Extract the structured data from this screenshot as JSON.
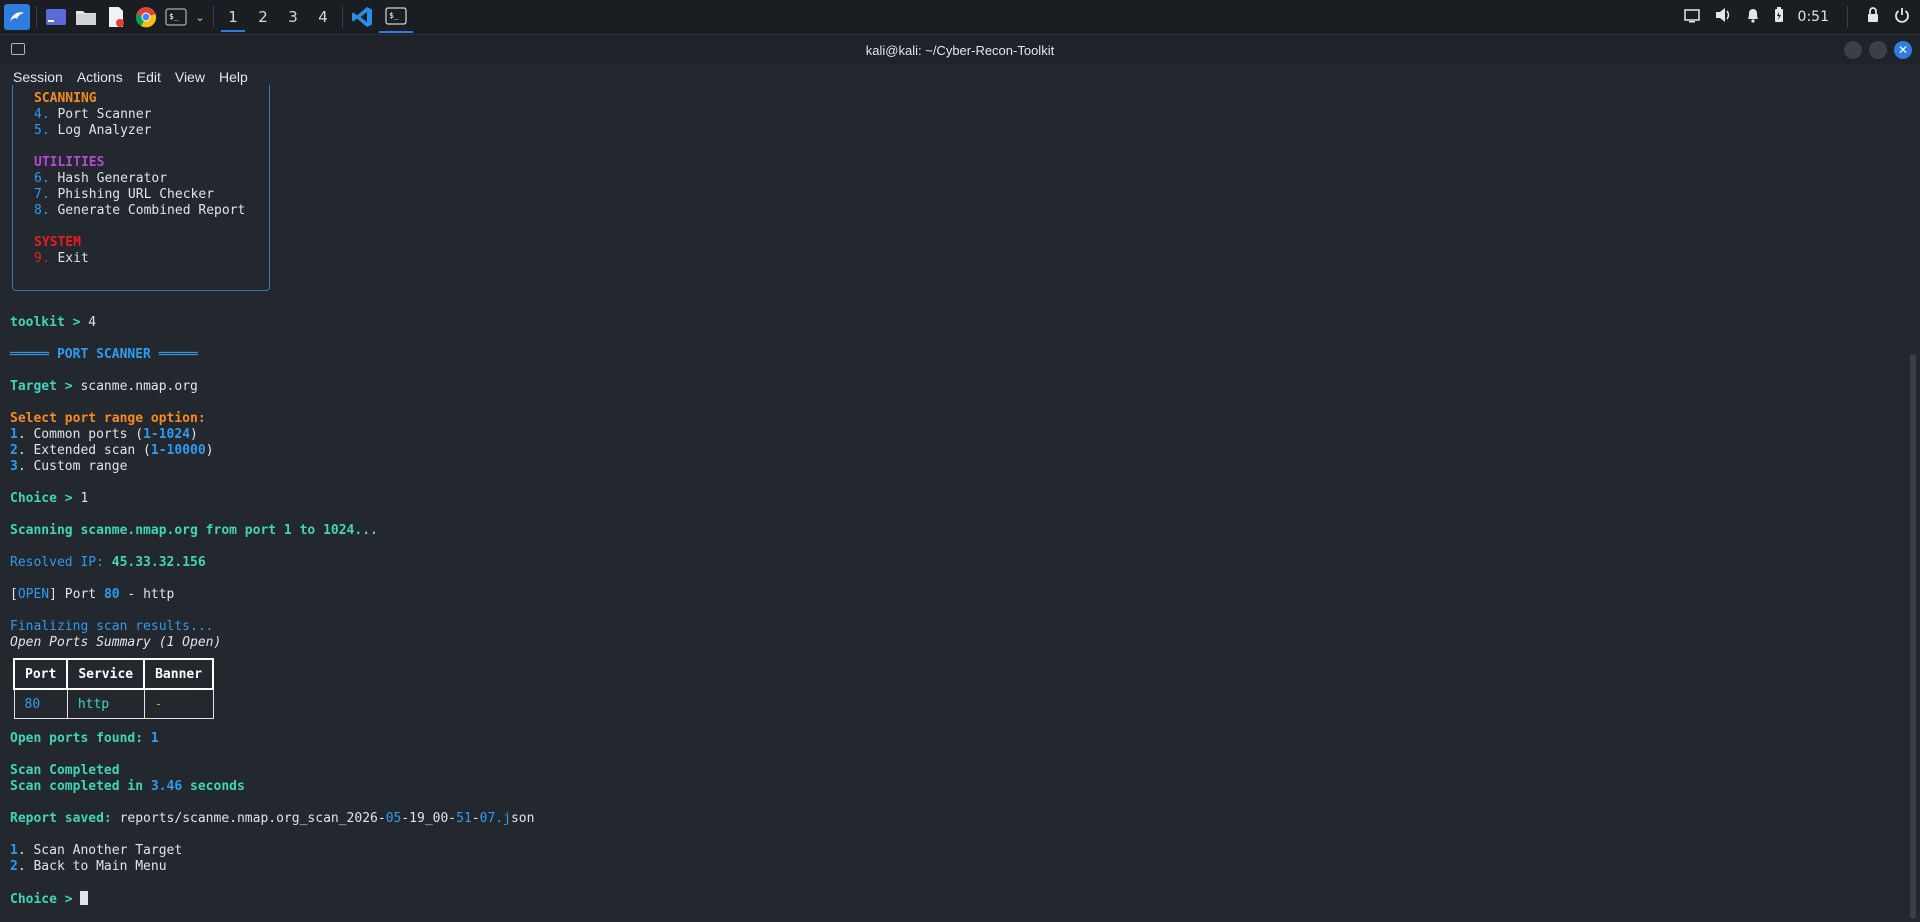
{
  "taskbar": {
    "workspaces": [
      "1",
      "2",
      "3",
      "4"
    ],
    "clock": "0:51",
    "icons": [
      "kali-dragon-icon",
      "desktop-icon",
      "file-manager-icon",
      "text-editor-icon",
      "chrome-icon",
      "terminal-icon",
      "chevron-down-icon",
      "vscode-icon",
      "terminal-window-icon"
    ],
    "tray_icons": [
      "display-icon",
      "volume-icon",
      "bell-icon",
      "battery-icon",
      "lock-icon",
      "power-icon"
    ]
  },
  "window": {
    "title": "kali@kali: ~/Cyber-Recon-Toolkit",
    "menu": [
      "Session",
      "Actions",
      "Edit",
      "View",
      "Help"
    ]
  },
  "colors": {
    "accent": "#2f7de1",
    "cyan": "#3fd6b8",
    "orange": "#f58b1f",
    "purple": "#b24cd6",
    "red": "#e81e1e",
    "background": "#23272e"
  },
  "terminal": {
    "scanning_header": "SCANNING",
    "item4": {
      "num": "4.",
      "label": "Port Scanner"
    },
    "item5": {
      "num": "5.",
      "label": "Log Analyzer"
    },
    "utilities_header": "UTILITIES",
    "item6": {
      "num": "6.",
      "label": "Hash Generator"
    },
    "item7": {
      "num": "7.",
      "label": "Phishing URL Checker"
    },
    "item8": {
      "num": "8.",
      "label": "Generate Combined Report"
    },
    "system_header": "SYSTEM",
    "item9": {
      "num": "9.",
      "label": "Exit"
    },
    "toolkit_prompt": "toolkit > ",
    "toolkit_input": "4",
    "port_scanner_banner": "═════ PORT SCANNER ═════",
    "target_prompt": "Target > ",
    "target_value": "scanme.nmap.org",
    "select_range": "Select port range option:",
    "opt1": {
      "num": "1",
      "text": ". Common ports (",
      "range": "1-1024",
      "close": ")"
    },
    "opt2": {
      "num": "2",
      "text": ". Extended scan (",
      "range": "1-10000",
      "close": ")"
    },
    "opt3": {
      "num": "3",
      "text": ". Custom range"
    },
    "choice_prompt": "Choice > ",
    "choice_value": "1",
    "scanning_msg": "Scanning scanme.nmap.org from port 1 to 1024...",
    "resolved_label": "Resolved IP: ",
    "resolved_ip": "45.33.32.156",
    "open_bracket_l": "[",
    "open_tag": "OPEN",
    "open_bracket_r": "]",
    "port_word": " Port ",
    "port_num": "80",
    "port_service": " - http",
    "finalizing": "Finalizing scan results...",
    "summary_title": "Open Ports Summary (1 Open)",
    "table": {
      "headers": [
        "Port",
        "Service",
        "Banner"
      ],
      "rows": [
        [
          "80",
          "http",
          "-"
        ]
      ]
    },
    "open_found_label": "Open ports found: ",
    "open_found_count": "1",
    "scan_completed": "Scan Completed",
    "scan_time_prefix": "Scan completed in ",
    "scan_time": "3.46",
    "scan_time_suffix": " seconds",
    "report_label": "Report saved: ",
    "report_path_a": "reports/scanme.nmap.org_scan_2026-",
    "report_path_b": "05",
    "report_path_c": "-19_00-",
    "report_path_d": "51",
    "report_path_e": "-",
    "report_path_f": "07.j",
    "report_path_g": "son",
    "next1": {
      "num": "1",
      "text": ". Scan Another Target"
    },
    "next2": {
      "num": "2",
      "text": ". Back to Main Menu"
    },
    "final_prompt": "Choice > "
  }
}
